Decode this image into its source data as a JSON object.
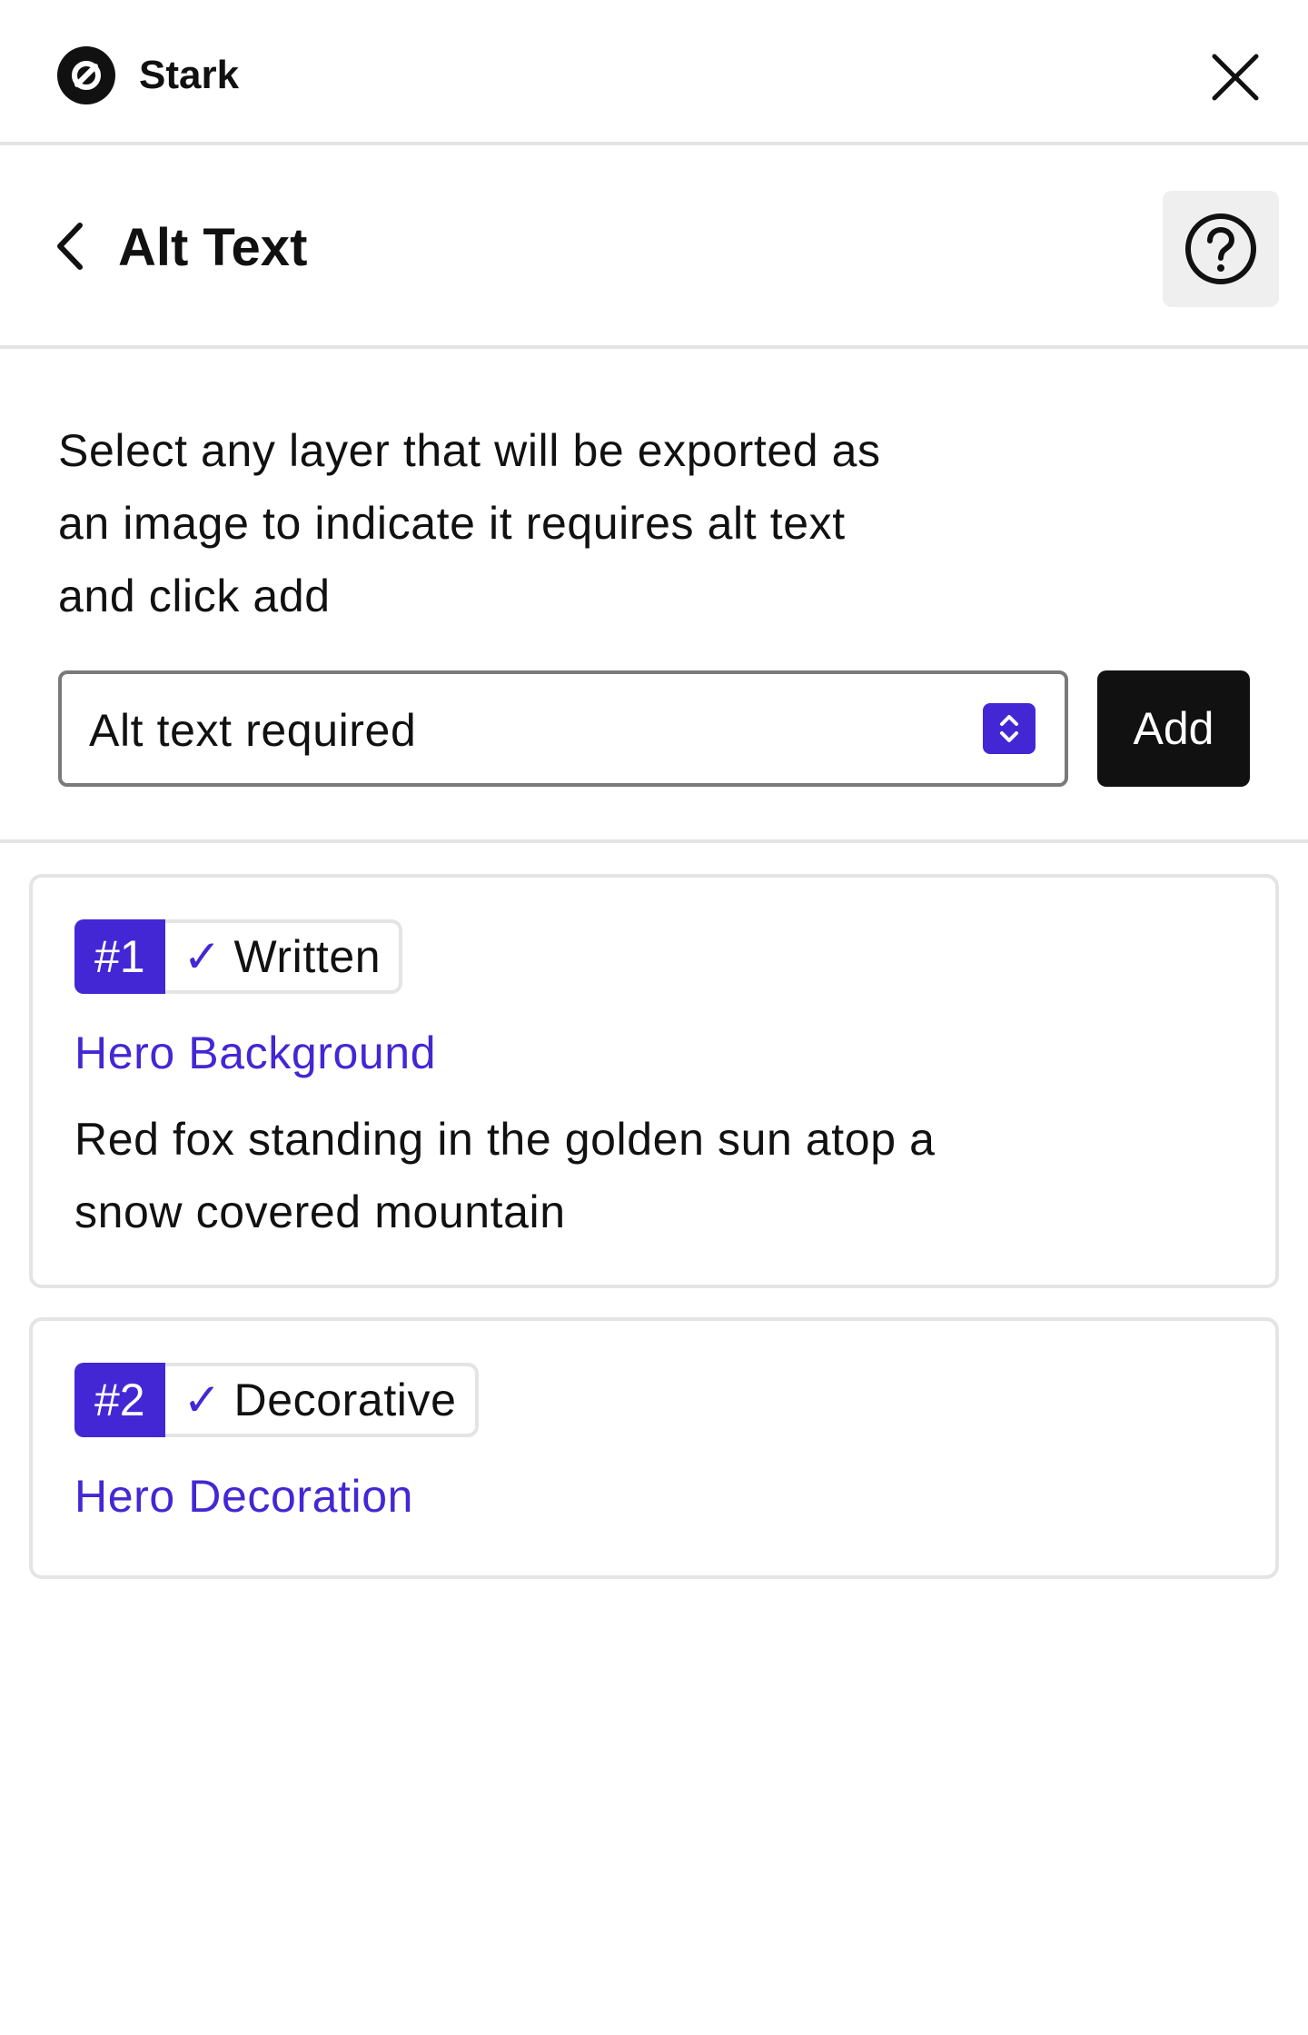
{
  "app": {
    "name": "Stark",
    "logo_icon": "stark-logo-icon",
    "close_icon": "close-icon"
  },
  "header": {
    "title": "Alt Text",
    "back_icon": "chevron-left-icon",
    "help_icon": "help-circle-icon"
  },
  "form": {
    "instructions": "Select any layer that will be exported as an image to indicate it requires alt text and click add",
    "select_value": "Alt text required",
    "select_caret_icon": "select-caret-icon",
    "add_label": "Add"
  },
  "items": [
    {
      "number": "#1",
      "status_check": "✓",
      "status": "Written",
      "layer_name": "Hero Background",
      "alt_text": "Red fox standing in the golden sun atop a snow covered mountain"
    },
    {
      "number": "#2",
      "status_check": "✓",
      "status": "Decorative",
      "layer_name": "Hero Decoration"
    }
  ],
  "colors": {
    "accent": "#4427d4",
    "primary_button": "#111111",
    "border": "#e4e4e4"
  }
}
